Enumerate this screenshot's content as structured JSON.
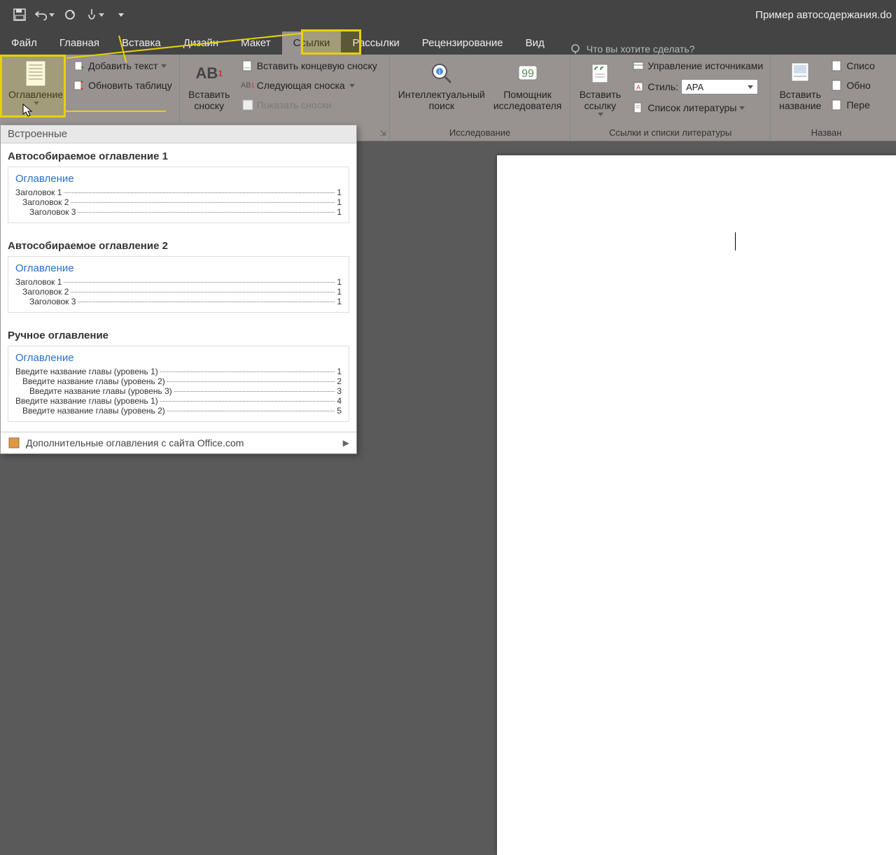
{
  "qat": {
    "title": "Пример автосодержания.do"
  },
  "tabs": [
    "Файл",
    "Главная",
    "Вставка",
    "Дизайн",
    "Макет",
    "Ссылки",
    "Рассылки",
    "Рецензирование",
    "Вид"
  ],
  "active_tab": 5,
  "tell_me": "Что вы хотите сделать?",
  "ribbon": {
    "toc": {
      "btn": "Оглавление",
      "add_text": "Добавить текст",
      "update": "Обновить таблицу"
    },
    "footnotes": {
      "insert": "Вставить\nсноску",
      "ab": "AB",
      "endnote": "Вставить концевую сноску",
      "next": "Следующая сноска",
      "show": "Показать сноски",
      "group": ""
    },
    "research": {
      "smart": "Интеллектуальный\nпоиск",
      "researcher": "Помощник\nисследователя",
      "group": "Исследование"
    },
    "citations": {
      "insert": "Вставить\nссылку",
      "manage": "Управление источниками",
      "style_lbl": "Стиль:",
      "style_val": "APA",
      "bibliography": "Список литературы",
      "group": "Ссылки и списки литературы"
    },
    "captions": {
      "insert": "Вставить\nназвание",
      "list": "Списо",
      "update": "Обно",
      "cross": "Пере",
      "group": "Назван"
    }
  },
  "gallery": {
    "builtin": "Встроенные",
    "items": [
      {
        "title": "Автособираемое оглавление 1",
        "head": "Оглавление",
        "rows": [
          {
            "t": "Заголовок 1",
            "p": "1",
            "l": 1
          },
          {
            "t": "Заголовок 2",
            "p": "1",
            "l": 2
          },
          {
            "t": "Заголовок 3",
            "p": "1",
            "l": 3
          }
        ]
      },
      {
        "title": "Автособираемое оглавление 2",
        "head": "Оглавление",
        "rows": [
          {
            "t": "Заголовок 1",
            "p": "1",
            "l": 1
          },
          {
            "t": "Заголовок 2",
            "p": "1",
            "l": 2
          },
          {
            "t": "Заголовок 3",
            "p": "1",
            "l": 3
          }
        ]
      },
      {
        "title": "Ручное оглавление",
        "head": "Оглавление",
        "rows": [
          {
            "t": "Введите название главы (уровень 1)",
            "p": "1",
            "l": 1
          },
          {
            "t": "Введите название главы (уровень 2)",
            "p": "2",
            "l": 2
          },
          {
            "t": "Введите название главы (уровень 3)",
            "p": "3",
            "l": 3
          },
          {
            "t": "Введите название главы (уровень 1)",
            "p": "4",
            "l": 1
          },
          {
            "t": "Введите название главы (уровень 2)",
            "p": "5",
            "l": 2
          }
        ]
      }
    ],
    "more": "Дополнительные оглавления с сайта Office.com"
  }
}
